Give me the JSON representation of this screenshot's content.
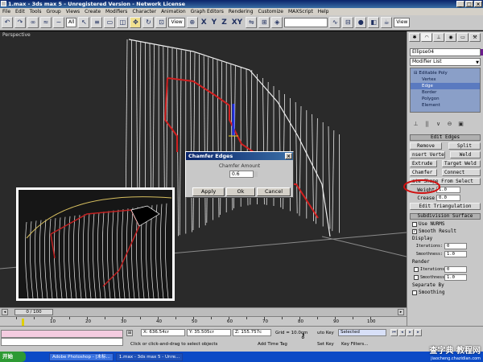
{
  "window": {
    "title": "1.max - 3ds max 5 - Unregistered Version - Network License",
    "controls": [
      "_",
      "□",
      "×"
    ]
  },
  "menu": [
    "File",
    "Edit",
    "Tools",
    "Group",
    "Views",
    "Create",
    "Modifiers",
    "Character",
    "Animation",
    "Graph Editors",
    "Rendering",
    "Customize",
    "MAXScript",
    "Help"
  ],
  "toolbar": {
    "filter": "All",
    "coord_system": "View",
    "view_label": "View",
    "axis_labels": [
      "X",
      "Y",
      "Z",
      "XY"
    ],
    "right_view": "View"
  },
  "viewport": {
    "label": "Perspective"
  },
  "dialog": {
    "title": "Chamfer Edges",
    "close": "×",
    "label": "Chamfer Amount",
    "value": "0.6",
    "apply": "Apply",
    "ok": "Ok",
    "cancel": "Cancel"
  },
  "panel": {
    "object_name": "Ellipse04",
    "modifier_list": "Modifier List",
    "stack": [
      {
        "label": "Editable Poly",
        "selected": false
      },
      {
        "label": "Vertex",
        "selected": false
      },
      {
        "label": "Edge",
        "selected": true
      },
      {
        "label": "Border",
        "selected": false
      },
      {
        "label": "Polygon",
        "selected": false
      },
      {
        "label": "Element",
        "selected": false
      }
    ],
    "edit_edges": {
      "header": "Edit Edges",
      "remove": "Remove",
      "split": "Split",
      "insert_vertex": "nsert Vertex",
      "weld": "Weld",
      "extrude": "Extrude",
      "target_weld": "Target Weld",
      "chamfer": "Chamfer",
      "connect": "Connect",
      "create_shape": "ate Shape From Select",
      "weight_label": "Weight",
      "weight": "1.0",
      "crease_label": "Crease",
      "crease": "0.0",
      "edit_triangulation": "Edit Triangulation"
    },
    "subdivision": {
      "header": "Subdivision Surface",
      "use_nurms": "Use NURMS",
      "smooth_result": "Smooth Result",
      "display": "Display",
      "iterations_label": "Iterations:",
      "iterations": "0",
      "smoothness_label": "Smoothness:",
      "smoothness": "1.0",
      "render": "Render",
      "iterations2": "0",
      "smoothness2": "1.0",
      "separate_by": "Separate By",
      "smoothing": "Smoothing"
    }
  },
  "timeline": {
    "slider": "0 / 100",
    "ticks": [
      "10",
      "20",
      "30",
      "40",
      "50",
      "60",
      "70",
      "80",
      "90",
      "100"
    ]
  },
  "status": {
    "x": "X: 636.54cr",
    "y": "Y: 35.505cr",
    "z": "Z: 155.757c",
    "grid": "Grid = 10.0cm",
    "prompt": "Click or click-and-drag to select objects",
    "add_time_tag": "Add Time Tag",
    "auto_key": "uto Key",
    "selected": "Selected",
    "set_key": "Set Key",
    "key_filters": "Key Filters..."
  },
  "taskbar": {
    "start": "开始",
    "tasks": [
      "Adobe Photoshop - [未标...",
      "1.max - 3ds max 5 - Unre..."
    ],
    "watermark": "查字典 教程网",
    "watermark_url": "jiaocheng.chazidian.com"
  }
}
